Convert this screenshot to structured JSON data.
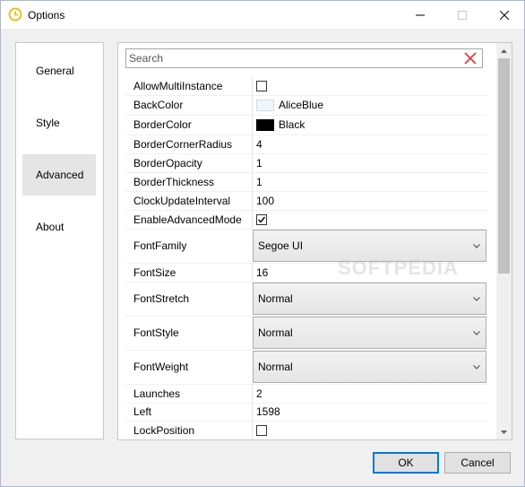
{
  "window": {
    "title": "Options",
    "icon": "clock-icon",
    "minimize": "minimize-icon",
    "maximize": "maximize-icon",
    "close": "close-icon"
  },
  "nav": {
    "items": [
      {
        "label": "General",
        "selected": false
      },
      {
        "label": "Style",
        "selected": false
      },
      {
        "label": "Advanced",
        "selected": true
      },
      {
        "label": "About",
        "selected": false
      }
    ]
  },
  "search": {
    "placeholder": "Search",
    "value": "",
    "clear_icon": "clear-x-icon",
    "clear_color": "#e03c3c"
  },
  "properties": [
    {
      "name": "AllowMultiInstance",
      "type": "checkbox",
      "checked": false
    },
    {
      "name": "BackColor",
      "type": "color",
      "value": "AliceBlue",
      "swatch": "#f0f8ff"
    },
    {
      "name": "BorderColor",
      "type": "color",
      "value": "Black",
      "swatch": "#000000"
    },
    {
      "name": "BorderCornerRadius",
      "type": "text",
      "value": "4"
    },
    {
      "name": "BorderOpacity",
      "type": "text",
      "value": "1"
    },
    {
      "name": "BorderThickness",
      "type": "text",
      "value": "1"
    },
    {
      "name": "ClockUpdateInterval",
      "type": "text",
      "value": "100"
    },
    {
      "name": "EnableAdvancedMode",
      "type": "checkbox",
      "checked": true
    },
    {
      "name": "FontFamily",
      "type": "combo",
      "value": "Segoe UI"
    },
    {
      "name": "FontSize",
      "type": "text",
      "value": "16"
    },
    {
      "name": "FontStretch",
      "type": "combo",
      "value": "Normal"
    },
    {
      "name": "FontStyle",
      "type": "combo",
      "value": "Normal"
    },
    {
      "name": "FontWeight",
      "type": "combo",
      "value": "Normal"
    },
    {
      "name": "Launches",
      "type": "text",
      "value": "2"
    },
    {
      "name": "Left",
      "type": "text",
      "value": "1598"
    },
    {
      "name": "LockPosition",
      "type": "checkbox",
      "checked": false
    }
  ],
  "watermark": "SOFTPEDIA",
  "buttons": {
    "ok": "OK",
    "cancel": "Cancel"
  },
  "colors": {
    "accent": "#0078d7",
    "clock_icon": "#f2b705"
  }
}
